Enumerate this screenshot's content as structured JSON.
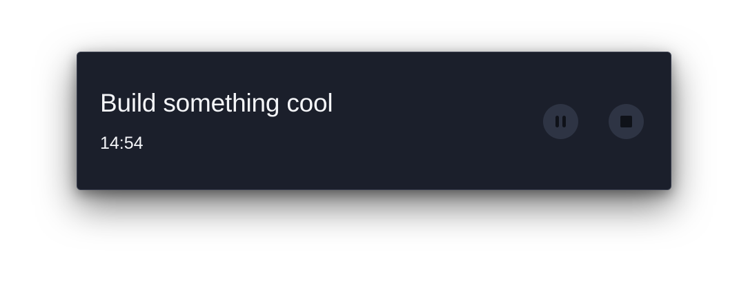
{
  "timer_widget": {
    "task_title": "Build something cool",
    "time_remaining": "14:54",
    "controls": {
      "pause_icon": "pause-icon",
      "stop_icon": "stop-icon"
    },
    "colors": {
      "background": "#1b1f2b",
      "text": "#f4f5f8",
      "button_background": "#2e3444",
      "button_icon": "#0f1219"
    }
  }
}
